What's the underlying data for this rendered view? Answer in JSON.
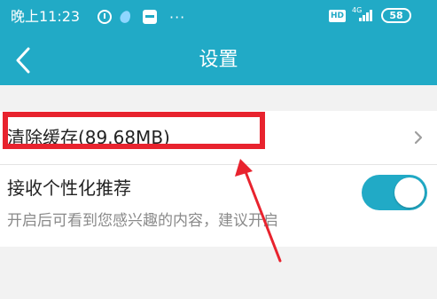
{
  "status_bar": {
    "time": "晚上11:23",
    "dots": "···",
    "hd_badge": "HD",
    "network": "4G",
    "battery": "58",
    "icons": [
      "alarm-icon",
      "drop-icon",
      "app-icon",
      "signal-icon",
      "battery-icon"
    ]
  },
  "header": {
    "title": "设置",
    "back_icon": "chevron-left-icon"
  },
  "settings": {
    "clear_cache": {
      "label": "清除缓存(89.68MB)",
      "icon": "chevron-right-icon"
    },
    "recommendation": {
      "title": "接收个性化推荐",
      "description": "开启后可看到您感兴趣的内容，建议开启",
      "enabled": true
    }
  },
  "colors": {
    "accent": "#21aac6",
    "background": "#f2f2f2",
    "annotation": "#e8232e"
  }
}
